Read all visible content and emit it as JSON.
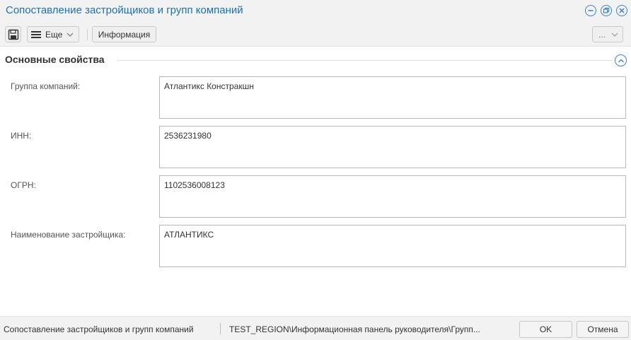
{
  "window": {
    "title": "Сопоставление застройщиков и групп компаний"
  },
  "toolbar": {
    "more_label": "Еще",
    "info_label": "Информация",
    "overflow_label": "..."
  },
  "section": {
    "title": "Основные свойства"
  },
  "fields": [
    {
      "label": "Группа компаний:",
      "value": "Атлантикс Констракшн"
    },
    {
      "label": "ИНН:",
      "value": "2536231980"
    },
    {
      "label": "ОГРН:",
      "value": "1102536008123"
    },
    {
      "label": "Наименование застройщика:",
      "value": "АТЛАНТИКС"
    }
  ],
  "status": {
    "form_name": "Сопоставление застройщиков и групп компаний",
    "path": "TEST_REGION\\Информационная панель руководителя\\Групп..."
  },
  "footer": {
    "ok_label": "OK",
    "cancel_label": "Отмена"
  },
  "colors": {
    "accent": "#1e6fb4",
    "icon_blue": "#3f82c2",
    "bar_bg": "#f2f2f2"
  },
  "icons": [
    "minimize-icon",
    "restore-icon",
    "close-icon",
    "save-icon",
    "menu-icon",
    "chevron-down-icon",
    "chevron-up-icon"
  ]
}
